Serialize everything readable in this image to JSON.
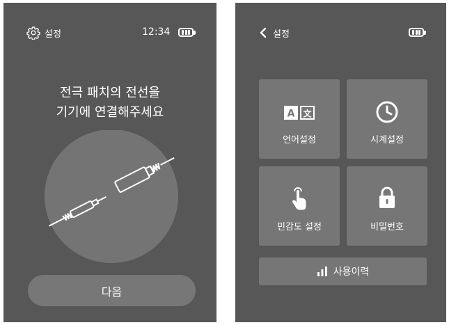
{
  "left_screen": {
    "status": {
      "settings_label": "설정",
      "time": "12:34"
    },
    "instruction_line1": "전극 패치의 전선을",
    "instruction_line2": "기기에 연결해주세요",
    "next_button": "다음"
  },
  "right_screen": {
    "header": {
      "back_label": "설정"
    },
    "tiles": [
      {
        "label": "언어설정",
        "icon": "language-icon"
      },
      {
        "label": "시계설정",
        "icon": "clock-icon"
      },
      {
        "label": "민감도 설정",
        "icon": "touch-hand-icon"
      },
      {
        "label": "비밀번호",
        "icon": "lock-icon"
      }
    ],
    "history_button": "사용이력"
  },
  "colors": {
    "screen_bg": "#575757",
    "tile_bg": "#767676",
    "circle_bg": "#747474",
    "text": "#ffffff"
  }
}
